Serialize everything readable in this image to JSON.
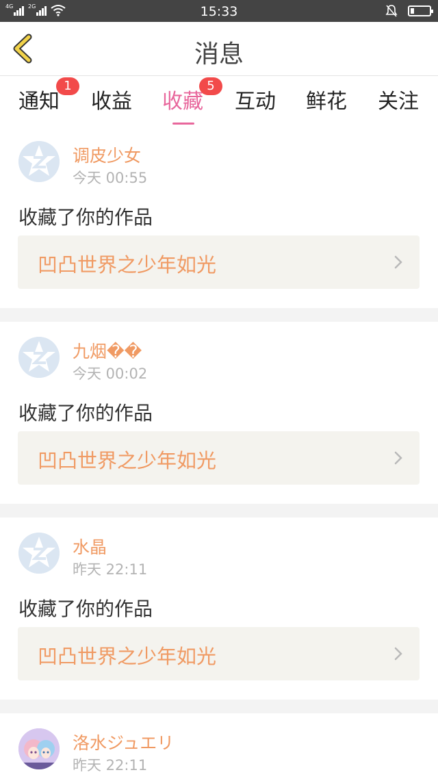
{
  "status_bar": {
    "network1": "4G",
    "network2": "2G",
    "time": "15:33",
    "icons": [
      "signal-icon",
      "wifi-icon",
      "silent-icon",
      "battery-icon"
    ]
  },
  "header": {
    "title": "消息",
    "back_icon": "back-chevron-icon"
  },
  "tabs": [
    {
      "label": "通知",
      "badge": "1"
    },
    {
      "label": "收益"
    },
    {
      "label": "收藏",
      "badge": "5",
      "active": true
    },
    {
      "label": "互动"
    },
    {
      "label": "鲜花"
    },
    {
      "label": "关注"
    }
  ],
  "messages": [
    {
      "user": "调皮少女",
      "time": "今天 00:55",
      "action": "收藏了你的作品",
      "work": "凹凸世界之少年如光",
      "avatar": "default-qzone-avatar"
    },
    {
      "user": "九烟��",
      "time": "今天 00:02",
      "action": "收藏了你的作品",
      "work": "凹凸世界之少年如光",
      "avatar": "default-qzone-avatar"
    },
    {
      "user": "水晶",
      "time": "昨天 22:11",
      "action": "收藏了你的作品",
      "work": "凹凸世界之少年如光",
      "avatar": "default-qzone-avatar"
    },
    {
      "user": "洛水ジュエリ",
      "time": "昨天 22:11",
      "avatar": "anime-girl-avatar"
    }
  ],
  "colors": {
    "accent_pink": "#e8679c",
    "accent_orange": "#f09a63",
    "badge_red": "#f24a4a",
    "back_yellow": "#f2d34a"
  }
}
